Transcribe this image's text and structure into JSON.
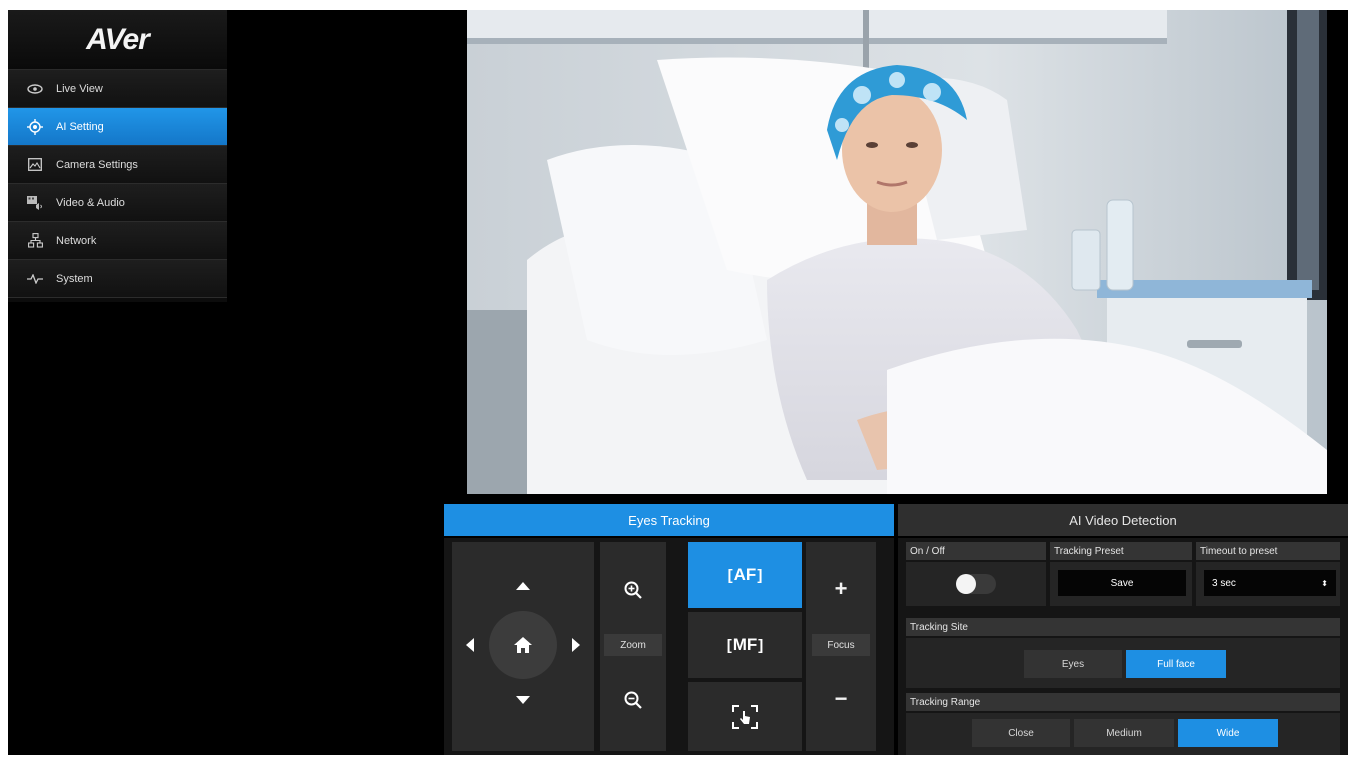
{
  "logo": "AVer",
  "sidebar": {
    "items": [
      {
        "label": "Live View",
        "icon": "eye-icon"
      },
      {
        "label": "AI Setting",
        "icon": "target-icon",
        "active": true
      },
      {
        "label": "Camera Settings",
        "icon": "image-icon"
      },
      {
        "label": "Video & Audio",
        "icon": "video-audio-icon"
      },
      {
        "label": "Network",
        "icon": "network-icon"
      },
      {
        "label": "System",
        "icon": "pulse-icon"
      }
    ]
  },
  "tabs": [
    {
      "label": "Eyes Tracking",
      "active": true
    },
    {
      "label": "AI Video Detection",
      "active": false
    }
  ],
  "ptz": {
    "zoom_label": "Zoom",
    "focus_label": "Focus",
    "af_label": "AF",
    "mf_label": "MF",
    "focus_plus": "+",
    "focus_minus": "−"
  },
  "detection": {
    "on_off_label": "On / Off",
    "tracking_preset_label": "Tracking Preset",
    "save_label": "Save",
    "timeout_label": "Timeout to preset",
    "timeout_value": "3 sec",
    "tracking_site_label": "Tracking Site",
    "site_options": [
      "Eyes",
      "Full face"
    ],
    "site_selected": "Full face",
    "tracking_range_label": "Tracking Range",
    "range_options": [
      "Close",
      "Medium",
      "Wide"
    ],
    "range_selected": "Wide"
  },
  "colors": {
    "accent": "#1e8fe3"
  }
}
